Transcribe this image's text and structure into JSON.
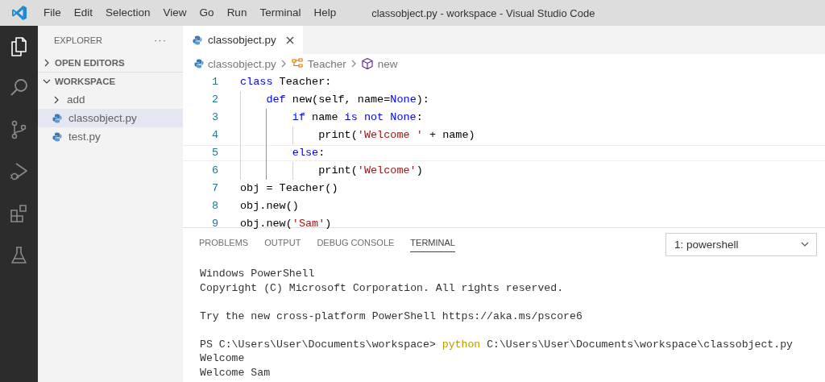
{
  "menu_bar": {
    "items": [
      "File",
      "Edit",
      "Selection",
      "View",
      "Go",
      "Run",
      "Terminal",
      "Help"
    ]
  },
  "window": {
    "title": "classobject.py - workspace - Visual Studio Code"
  },
  "activity_bar": [
    {
      "kind": "files",
      "selected": true
    },
    {
      "kind": "search",
      "selected": false
    },
    {
      "kind": "source-control",
      "selected": false
    },
    {
      "kind": "run",
      "selected": false
    },
    {
      "kind": "extensions",
      "selected": false
    },
    {
      "kind": "flask",
      "selected": false
    }
  ],
  "sidebar": {
    "title": "EXPLORER",
    "more": "···",
    "sections": [
      {
        "label": "OPEN EDITORS",
        "expanded": false
      },
      {
        "label": "WORKSPACE",
        "expanded": true,
        "items": [
          {
            "label": "add",
            "kind": "folder",
            "expanded": false,
            "selected": false
          },
          {
            "label": "classobject.py",
            "kind": "python",
            "selected": true
          },
          {
            "label": "test.py",
            "kind": "python",
            "selected": false
          }
        ]
      }
    ]
  },
  "tabs": [
    {
      "label": "classobject.py",
      "selected": true
    }
  ],
  "breadcrumb": [
    {
      "text": "classobject.py",
      "kind": "python"
    },
    {
      "text": "Teacher",
      "kind": "class"
    },
    {
      "text": "new",
      "kind": "method"
    }
  ],
  "code": [
    {
      "number": "1",
      "current": false,
      "tokens": [
        {
          "text": "class",
          "kind": "keyword"
        },
        {
          "text": " Teacher:",
          "kind": "plain"
        }
      ],
      "children": [
        {
          "number": "2",
          "current": false,
          "tokens": [
            {
              "text": "def",
              "kind": "keyword"
            },
            {
              "text": " new(self, name=",
              "kind": "plain"
            },
            {
              "text": "None",
              "kind": "keyword"
            },
            {
              "text": "):",
              "kind": "plain"
            }
          ],
          "children": [
            {
              "number": "3",
              "current": false,
              "tokens": [
                {
                  "text": "if",
                  "kind": "keyword"
                },
                {
                  "text": " name ",
                  "kind": "plain"
                },
                {
                  "text": "is not None",
                  "kind": "keyword"
                },
                {
                  "text": ":",
                  "kind": "plain"
                }
              ],
              "children": [
                {
                  "number": "4",
                  "current": false,
                  "tokens": [
                    {
                      "text": "print(",
                      "kind": "plain"
                    },
                    {
                      "text": "'Welcome '",
                      "kind": "string"
                    },
                    {
                      "text": " + name)",
                      "kind": "plain"
                    }
                  ]
                }
              ]
            },
            {
              "number": "5",
              "current": true,
              "tokens": [
                {
                  "text": "else",
                  "kind": "keyword"
                },
                {
                  "text": ":",
                  "kind": "plain"
                }
              ],
              "children": [
                {
                  "number": "6",
                  "current": false,
                  "tokens": [
                    {
                      "text": "print(",
                      "kind": "plain"
                    },
                    {
                      "text": "'Welcome'",
                      "kind": "string"
                    },
                    {
                      "text": ")",
                      "kind": "plain"
                    }
                  ]
                }
              ]
            }
          ]
        }
      ]
    },
    {
      "number": "7",
      "current": false,
      "tokens": [
        {
          "text": "obj = Teacher()",
          "kind": "plain"
        }
      ]
    },
    {
      "number": "8",
      "current": false,
      "tokens": [
        {
          "text": "obj.new()",
          "kind": "plain"
        }
      ]
    },
    {
      "number": "9",
      "current": false,
      "tokens": [
        {
          "text": "obj.new(",
          "kind": "plain"
        },
        {
          "text": "'Sam'",
          "kind": "string"
        },
        {
          "text": ")",
          "kind": "plain"
        }
      ]
    }
  ],
  "panel": {
    "tabs": [
      {
        "label": "PROBLEMS",
        "selected": false
      },
      {
        "label": "OUTPUT",
        "selected": false
      },
      {
        "label": "DEBUG CONSOLE",
        "selected": false
      },
      {
        "label": "TERMINAL",
        "selected": true
      }
    ],
    "terminal_select": {
      "value": "1: powershell"
    },
    "terminal": [
      [
        [
          {
            "text": "Windows PowerShell",
            "kind": "output"
          }
        ],
        [
          {
            "text": "Copyright (C) Microsoft Corporation. All rights reserved.",
            "kind": "output"
          }
        ]
      ],
      [
        [
          {
            "text": "Try the new cross-platform PowerShell https://aka.ms/pscore6",
            "kind": "output"
          }
        ]
      ],
      [
        [
          {
            "text": "PS C:\\Users\\User\\Documents\\workspace> ",
            "kind": "output"
          },
          {
            "text": "python",
            "kind": "command"
          },
          {
            "text": " C:\\Users\\User\\Documents\\workspace\\classobject.py",
            "kind": "output"
          }
        ],
        [
          {
            "text": "Welcome",
            "kind": "output"
          }
        ],
        [
          {
            "text": "Welcome Sam",
            "kind": "output"
          }
        ]
      ]
    ]
  }
}
